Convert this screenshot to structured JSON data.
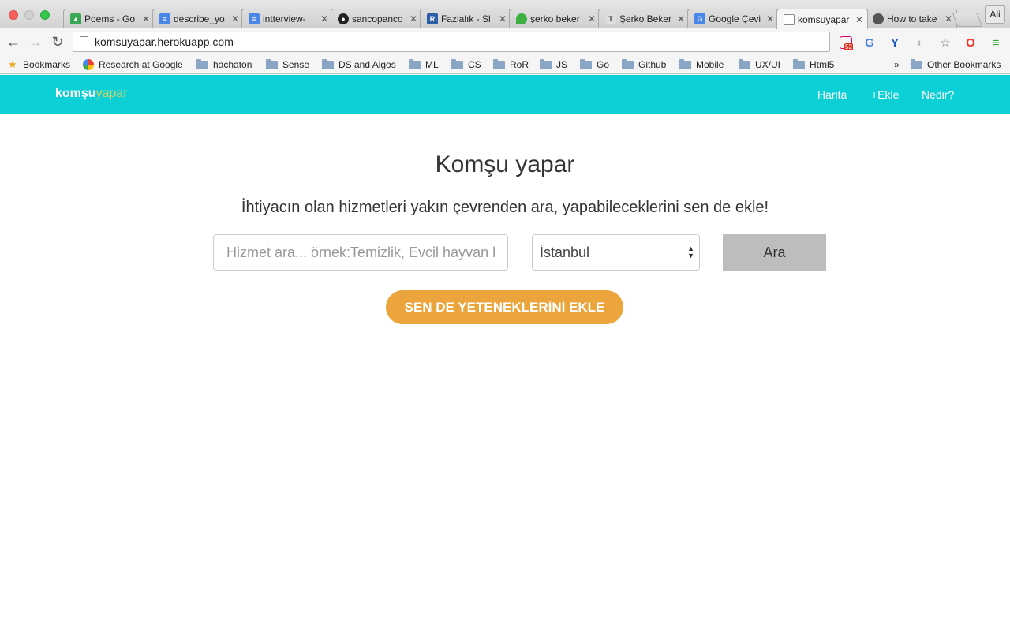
{
  "browser": {
    "tabs": [
      {
        "title": "Poems - Go",
        "icon": "google-drive-icon",
        "color": "#3aa757"
      },
      {
        "title": "describe_yo",
        "icon": "google-docs-icon",
        "color": "#4a86e8"
      },
      {
        "title": "intterview-",
        "icon": "google-docs-icon",
        "color": "#4a86e8"
      },
      {
        "title": "sancopanco",
        "icon": "github-icon",
        "color": "#222222"
      },
      {
        "title": "Fazlalık - Sl",
        "icon": "r-logo-icon",
        "color": "#2b5ea7"
      },
      {
        "title": "şerko beker",
        "icon": "drop-icon",
        "color": "#3cb043"
      },
      {
        "title": "Şerko Beker",
        "icon": "t-logo-icon",
        "color": "#666666"
      },
      {
        "title": "Google Çevi",
        "icon": "google-translate-icon",
        "color": "#4a86e8"
      },
      {
        "title": "komsuyapar",
        "icon": "page-icon",
        "color": "#888888"
      },
      {
        "title": "How to take",
        "icon": "apple-icon",
        "color": "#555555"
      }
    ],
    "profile_label": "Ali",
    "url": "komsuyapar.herokuapp.com",
    "calendar_badge": "52",
    "bookmarks": [
      {
        "label": "Bookmarks",
        "icon": "star-icon"
      },
      {
        "label": "Research at Google",
        "icon": "google-icon"
      },
      {
        "label": "hachaton",
        "icon": "folder-icon"
      },
      {
        "label": "Sense",
        "icon": "folder-icon"
      },
      {
        "label": "DS and Algos",
        "icon": "folder-icon"
      },
      {
        "label": "ML",
        "icon": "folder-icon"
      },
      {
        "label": "CS",
        "icon": "folder-icon"
      },
      {
        "label": "RoR",
        "icon": "folder-icon"
      },
      {
        "label": "JS",
        "icon": "folder-icon"
      },
      {
        "label": "Go",
        "icon": "folder-icon"
      },
      {
        "label": "Github",
        "icon": "folder-icon"
      },
      {
        "label": "Mobile",
        "icon": "folder-icon"
      },
      {
        "label": "UX/UI",
        "icon": "folder-icon"
      },
      {
        "label": "Html5",
        "icon": "folder-icon"
      }
    ],
    "overflow_label": "»",
    "other_bookmarks": "Other Bookmarks"
  },
  "site": {
    "brand_part1": "komşu",
    "brand_part2": "yapar",
    "nav": [
      {
        "label": "Harita"
      },
      {
        "label": "+Ekle"
      },
      {
        "label": "Nedir?"
      }
    ],
    "title": "Komşu yapar",
    "subtitle": "İhtiyacın olan hizmetleri yakın çevrenden ara, yapabileceklerini sen de ekle!",
    "search_placeholder": "Hizmet ara... örnek:Temizlik, Evcil hayvan bakımı",
    "city_value": "İstanbul",
    "search_button": "Ara",
    "cta_button": "SEN DE YETENEKLERİNİ EKLE",
    "colors": {
      "navbar": "#0dcfd6",
      "cta": "#eca43c",
      "search_button": "#bdbdbd"
    }
  }
}
